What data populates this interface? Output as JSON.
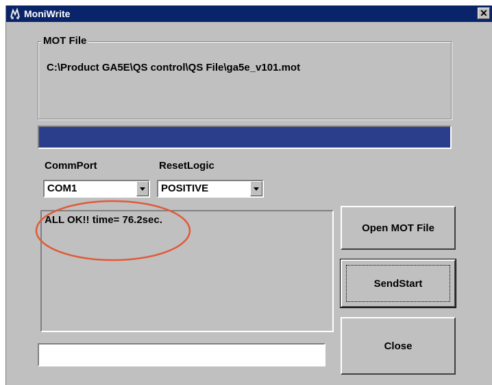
{
  "window": {
    "title": "MoniWrite",
    "close_glyph": "✕"
  },
  "mot_file": {
    "legend": "MOT File",
    "path": "C:\\Product GA5E\\QS control\\QS File\\ga5e_v101.mot"
  },
  "progress": {
    "fraction": 1.0,
    "color": "#2a3e8c"
  },
  "comm_port": {
    "label": "CommPort",
    "value": "COM1"
  },
  "reset_logic": {
    "label": "ResetLogic",
    "value": "POSITIVE"
  },
  "log": {
    "text": "ALL OK!! time= 76.2sec."
  },
  "buttons": {
    "open": "Open MOT File",
    "send": "SendStart",
    "close": "Close"
  },
  "status": {
    "value": ""
  },
  "colors": {
    "titlebar": "#0a246a",
    "face": "#c0c0c0",
    "highlight_ring": "#e05a3a"
  }
}
